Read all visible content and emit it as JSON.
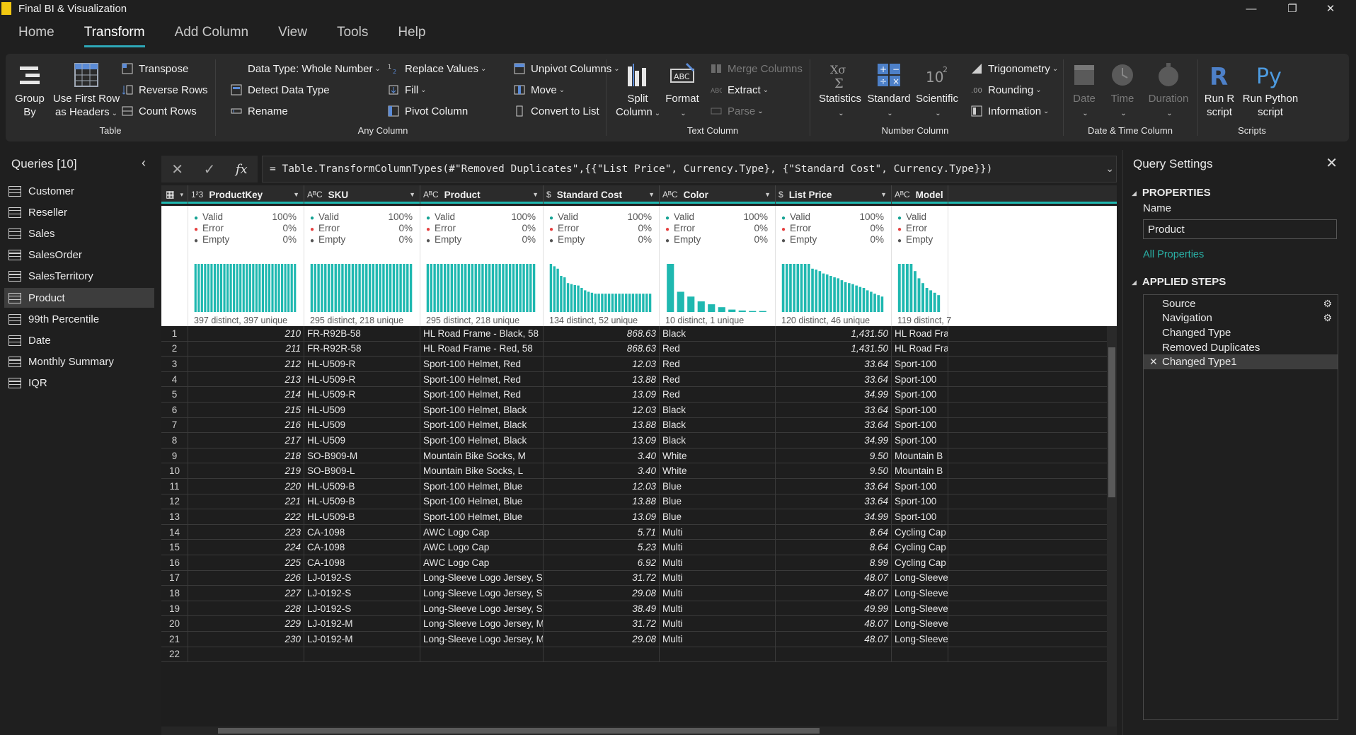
{
  "window": {
    "title": "Final BI & Visualization"
  },
  "menu": {
    "tabs": [
      "Home",
      "Transform",
      "Add Column",
      "View",
      "Tools",
      "Help"
    ],
    "active": "Transform"
  },
  "ribbon": {
    "table": {
      "label": "Table",
      "group_by": "Group\nBy",
      "use_first_row": "Use First Row\nas Headers",
      "transpose": "Transpose",
      "reverse_rows": "Reverse Rows",
      "count_rows": "Count Rows"
    },
    "any_column": {
      "label": "Any Column",
      "data_type": "Data Type: Whole Number",
      "detect_data_type": "Detect Data Type",
      "rename": "Rename",
      "replace_values": "Replace Values",
      "fill": "Fill",
      "pivot_column": "Pivot Column",
      "unpivot_columns": "Unpivot Columns",
      "move": "Move",
      "convert_to_list": "Convert to List"
    },
    "text_column": {
      "label": "Text Column",
      "split_column": "Split\nColumn",
      "format": "Format",
      "merge_columns": "Merge Columns",
      "extract": "Extract",
      "parse": "Parse"
    },
    "number_column": {
      "label": "Number Column",
      "statistics": "Statistics",
      "standard": "Standard",
      "scientific": "Scientific",
      "trigonometry": "Trigonometry",
      "rounding": "Rounding",
      "information": "Information"
    },
    "datetime_column": {
      "label": "Date & Time Column",
      "date": "Date",
      "time": "Time",
      "duration": "Duration"
    },
    "scripts": {
      "label": "Scripts",
      "run_r": "Run R\nscript",
      "run_python": "Run Python\nscript"
    }
  },
  "queries": {
    "header": "Queries [10]",
    "items": [
      "Customer",
      "Reseller",
      "Sales",
      "SalesOrder",
      "SalesTerritory",
      "Product",
      "99th Percentile",
      "Date",
      "Monthly Summary",
      "IQR"
    ],
    "active": "Product"
  },
  "formula": {
    "text": "= Table.TransformColumnTypes(#\"Removed Duplicates\",{{\"List Price\", Currency.Type}, {\"Standard Cost\", Currency.Type}})"
  },
  "columns": [
    {
      "type": "1²3",
      "name": "ProductKey",
      "valid": "100%",
      "error": "0%",
      "empty": "0%",
      "distinct": "397 distinct, 397 unique",
      "bars": [
        1,
        1,
        1,
        1,
        1,
        1,
        1,
        1,
        1,
        1,
        1,
        1,
        1,
        1,
        1,
        1,
        1,
        1,
        1,
        1,
        1,
        1,
        1,
        1,
        1,
        1,
        1,
        1,
        1,
        1,
        1,
        1
      ]
    },
    {
      "type": "A^B_C",
      "name": "SKU",
      "valid": "100%",
      "error": "0%",
      "empty": "0%",
      "distinct": "295 distinct, 218 unique",
      "bars": [
        1,
        1,
        1,
        1,
        1,
        1,
        1,
        1,
        1,
        1,
        1,
        1,
        1,
        1,
        1,
        1,
        1,
        1,
        1,
        1,
        1,
        1,
        1,
        1,
        1,
        1,
        1,
        1,
        1,
        1
      ]
    },
    {
      "type": "A^B_C",
      "name": "Product",
      "valid": "100%",
      "error": "0%",
      "empty": "0%",
      "distinct": "295 distinct, 218 unique",
      "bars": [
        1,
        1,
        1,
        1,
        1,
        1,
        1,
        1,
        1,
        1,
        1,
        1,
        1,
        1,
        1,
        1,
        1,
        1,
        1,
        1,
        1,
        1,
        1,
        1,
        1,
        1,
        1,
        1,
        1,
        1,
        1,
        1
      ]
    },
    {
      "type": "$",
      "name": "Standard Cost",
      "valid": "100%",
      "error": "0%",
      "empty": "0%",
      "distinct": "134 distinct, 52 unique",
      "bars": [
        1,
        0.95,
        0.9,
        0.75,
        0.72,
        0.6,
        0.58,
        0.56,
        0.55,
        0.5,
        0.45,
        0.42,
        0.4,
        0.38,
        0.38,
        0.38,
        0.38,
        0.38,
        0.38,
        0.38,
        0.38,
        0.38,
        0.38,
        0.38,
        0.38,
        0.38,
        0.38,
        0.38,
        0.38,
        0.38
      ]
    },
    {
      "type": "A^B_C",
      "name": "Color",
      "valid": "100%",
      "error": "0%",
      "empty": "0%",
      "distinct": "10 distinct, 1 unique",
      "bars": [
        1,
        0.42,
        0.32,
        0.22,
        0.16,
        0.1,
        0.05,
        0.03,
        0.02,
        0.02
      ]
    },
    {
      "type": "$",
      "name": "List Price",
      "valid": "100%",
      "error": "0%",
      "empty": "0%",
      "distinct": "120 distinct, 46 unique",
      "bars": [
        1,
        1,
        1,
        1,
        1,
        1,
        1,
        1,
        0.9,
        0.88,
        0.85,
        0.8,
        0.78,
        0.75,
        0.72,
        0.7,
        0.66,
        0.62,
        0.6,
        0.58,
        0.55,
        0.52,
        0.5,
        0.45,
        0.42,
        0.38,
        0.35,
        0.32
      ]
    },
    {
      "type": "A^B_C",
      "name": "Model",
      "valid": "Valid",
      "error": "Error",
      "empty": "Empty",
      "distinct": "119 distinct, 7",
      "bars": [
        1,
        1,
        1,
        1,
        0.85,
        0.7,
        0.6,
        0.5,
        0.45,
        0.4,
        0.35
      ]
    }
  ],
  "profile_labels": {
    "valid": "Valid",
    "error": "Error",
    "empty": "Empty"
  },
  "rows": [
    [
      "1",
      "210",
      "FR-R92B-58",
      "HL Road Frame - Black, 58",
      "868.63",
      "Black",
      "1,431.50",
      "HL Road Fra"
    ],
    [
      "2",
      "211",
      "FR-R92R-58",
      "HL Road Frame - Red, 58",
      "868.63",
      "Red",
      "1,431.50",
      "HL Road Fra"
    ],
    [
      "3",
      "212",
      "HL-U509-R",
      "Sport-100 Helmet, Red",
      "12.03",
      "Red",
      "33.64",
      "Sport-100"
    ],
    [
      "4",
      "213",
      "HL-U509-R",
      "Sport-100 Helmet, Red",
      "13.88",
      "Red",
      "33.64",
      "Sport-100"
    ],
    [
      "5",
      "214",
      "HL-U509-R",
      "Sport-100 Helmet, Red",
      "13.09",
      "Red",
      "34.99",
      "Sport-100"
    ],
    [
      "6",
      "215",
      "HL-U509",
      "Sport-100 Helmet, Black",
      "12.03",
      "Black",
      "33.64",
      "Sport-100"
    ],
    [
      "7",
      "216",
      "HL-U509",
      "Sport-100 Helmet, Black",
      "13.88",
      "Black",
      "33.64",
      "Sport-100"
    ],
    [
      "8",
      "217",
      "HL-U509",
      "Sport-100 Helmet, Black",
      "13.09",
      "Black",
      "34.99",
      "Sport-100"
    ],
    [
      "9",
      "218",
      "SO-B909-M",
      "Mountain Bike Socks, M",
      "3.40",
      "White",
      "9.50",
      "Mountain B"
    ],
    [
      "10",
      "219",
      "SO-B909-L",
      "Mountain Bike Socks, L",
      "3.40",
      "White",
      "9.50",
      "Mountain B"
    ],
    [
      "11",
      "220",
      "HL-U509-B",
      "Sport-100 Helmet, Blue",
      "12.03",
      "Blue",
      "33.64",
      "Sport-100"
    ],
    [
      "12",
      "221",
      "HL-U509-B",
      "Sport-100 Helmet, Blue",
      "13.88",
      "Blue",
      "33.64",
      "Sport-100"
    ],
    [
      "13",
      "222",
      "HL-U509-B",
      "Sport-100 Helmet, Blue",
      "13.09",
      "Blue",
      "34.99",
      "Sport-100"
    ],
    [
      "14",
      "223",
      "CA-1098",
      "AWC Logo Cap",
      "5.71",
      "Multi",
      "8.64",
      "Cycling Cap"
    ],
    [
      "15",
      "224",
      "CA-1098",
      "AWC Logo Cap",
      "5.23",
      "Multi",
      "8.64",
      "Cycling Cap"
    ],
    [
      "16",
      "225",
      "CA-1098",
      "AWC Logo Cap",
      "6.92",
      "Multi",
      "8.99",
      "Cycling Cap"
    ],
    [
      "17",
      "226",
      "LJ-0192-S",
      "Long-Sleeve Logo Jersey, S",
      "31.72",
      "Multi",
      "48.07",
      "Long-Sleeve"
    ],
    [
      "18",
      "227",
      "LJ-0192-S",
      "Long-Sleeve Logo Jersey, S",
      "29.08",
      "Multi",
      "48.07",
      "Long-Sleeve"
    ],
    [
      "19",
      "228",
      "LJ-0192-S",
      "Long-Sleeve Logo Jersey, S",
      "38.49",
      "Multi",
      "49.99",
      "Long-Sleeve"
    ],
    [
      "20",
      "229",
      "LJ-0192-M",
      "Long-Sleeve Logo Jersey, M",
      "31.72",
      "Multi",
      "48.07",
      "Long-Sleeve"
    ],
    [
      "21",
      "230",
      "LJ-0192-M",
      "Long-Sleeve Logo Jersey, M",
      "29.08",
      "Multi",
      "48.07",
      "Long-Sleeve"
    ],
    [
      "22",
      "",
      "",
      "",
      "",
      "",
      "",
      ""
    ]
  ],
  "settings": {
    "title": "Query Settings",
    "properties": "PROPERTIES",
    "name_label": "Name",
    "name_value": "Product",
    "all_properties": "All Properties",
    "applied_steps": "APPLIED STEPS",
    "steps": [
      "Source",
      "Navigation",
      "Changed Type",
      "Removed Duplicates",
      "Changed Type1"
    ],
    "steps_with_gear": [
      "Source",
      "Navigation"
    ],
    "active_step": "Changed Type1"
  },
  "colors": {
    "accent": "#1fb8b0",
    "valid": "#16a394",
    "error": "#e53e3e",
    "bar": "#1fb8b0"
  }
}
